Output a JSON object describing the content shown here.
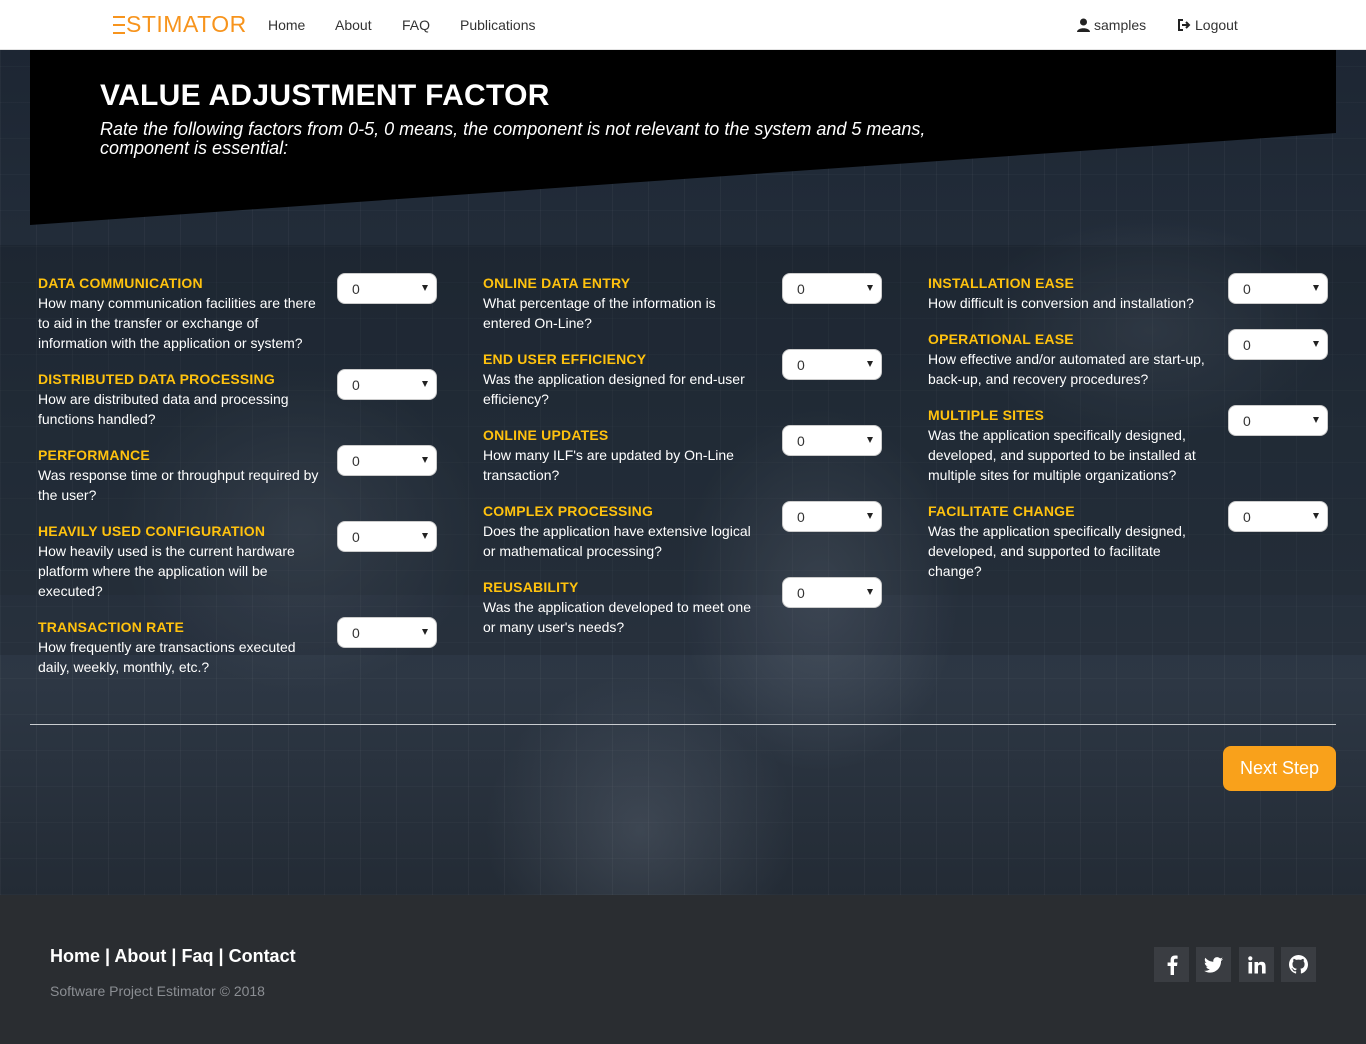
{
  "brand": {
    "name": "STIMATOR",
    "logo_letter": "E"
  },
  "nav": {
    "links": [
      "Home",
      "About",
      "FAQ",
      "Publications"
    ],
    "user": "samples",
    "logout": "Logout"
  },
  "hero": {
    "title": "VALUE ADJUSTMENT FACTOR",
    "subtitle": "Rate the following factors from 0-5, 0 means, the component is not relevant to the system and 5 means, component is essential:"
  },
  "factors": [
    {
      "title": "DATA COMMUNICATION",
      "desc": "How many communication facilities are there to aid in the transfer or exchange of information with the application or system?",
      "value": "0"
    },
    {
      "title": "DISTRIBUTED DATA PROCESSING",
      "desc": "How are distributed data and processing functions handled?",
      "value": "0"
    },
    {
      "title": "PERFORMANCE",
      "desc": "Was response time or throughput required by the user?",
      "value": "0"
    },
    {
      "title": "HEAVILY USED CONFIGURATION",
      "desc": "How heavily used is the current hardware platform where the application will be executed?",
      "value": "0"
    },
    {
      "title": "TRANSACTION RATE",
      "desc": "How frequently are transactions executed daily, weekly, monthly, etc.?",
      "value": "0"
    },
    {
      "title": "ONLINE DATA ENTRY",
      "desc": "What percentage of the information is entered On-Line?",
      "value": "0"
    },
    {
      "title": "END USER EFFICIENCY",
      "desc": "Was the application designed for end-user efficiency?",
      "value": "0"
    },
    {
      "title": "ONLINE UPDATES",
      "desc": "How many ILF's are updated by On-Line transaction?",
      "value": "0"
    },
    {
      "title": "COMPLEX PROCESSING",
      "desc": "Does the application have extensive logical or mathematical processing?",
      "value": "0"
    },
    {
      "title": "REUSABILITY",
      "desc": "Was the application developed to meet one or many user's needs?",
      "value": "0"
    },
    {
      "title": "INSTALLATION EASE",
      "desc": "How difficult is conversion and installation?",
      "value": "0"
    },
    {
      "title": "OPERATIONAL EASE",
      "desc": "How effective and/or automated are start-up, back-up, and recovery procedures?",
      "value": "0"
    },
    {
      "title": "MULTIPLE SITES",
      "desc": "Was the application specifically designed, developed, and supported to be installed at multiple sites for multiple organizations?",
      "value": "0"
    },
    {
      "title": "FACILITATE CHANGE",
      "desc": "Was the application specifically designed, developed, and supported to facilitate change?",
      "value": "0"
    }
  ],
  "next_button": "Next Step",
  "footer": {
    "links": [
      "Home",
      "About",
      "Faq",
      "Contact"
    ],
    "separator": "|",
    "copyright": "Software Project Estimator © 2018",
    "social_icons": [
      "facebook-icon",
      "twitter-icon",
      "linkedin-icon",
      "github-icon"
    ]
  },
  "colors": {
    "accent": "#f9a11b",
    "brand": "#f7941d",
    "factor_title": "#ffc20e",
    "hero_bg": "#000000",
    "footer_bg": "#2a2d31"
  }
}
